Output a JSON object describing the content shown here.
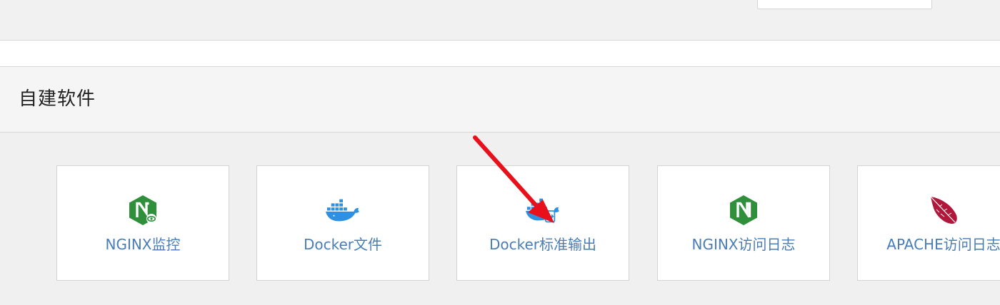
{
  "section": {
    "title": "自建软件"
  },
  "cards": [
    {
      "label": "NGINX监控",
      "icon": "nginx-monitor-icon"
    },
    {
      "label": "Docker文件",
      "icon": "docker-icon"
    },
    {
      "label": "Docker标准输出",
      "icon": "docker-stdout-icon"
    },
    {
      "label": "NGINX访问日志",
      "icon": "nginx-icon"
    },
    {
      "label": "APACHE访问日志",
      "icon": "apache-feather-icon"
    }
  ],
  "colors": {
    "label": "#4a7db5",
    "nginx_green": "#2f8f3a",
    "docker_blue": "#2f8fe0",
    "apache_red": "#b0173a",
    "arrow_red": "#e8111b"
  }
}
